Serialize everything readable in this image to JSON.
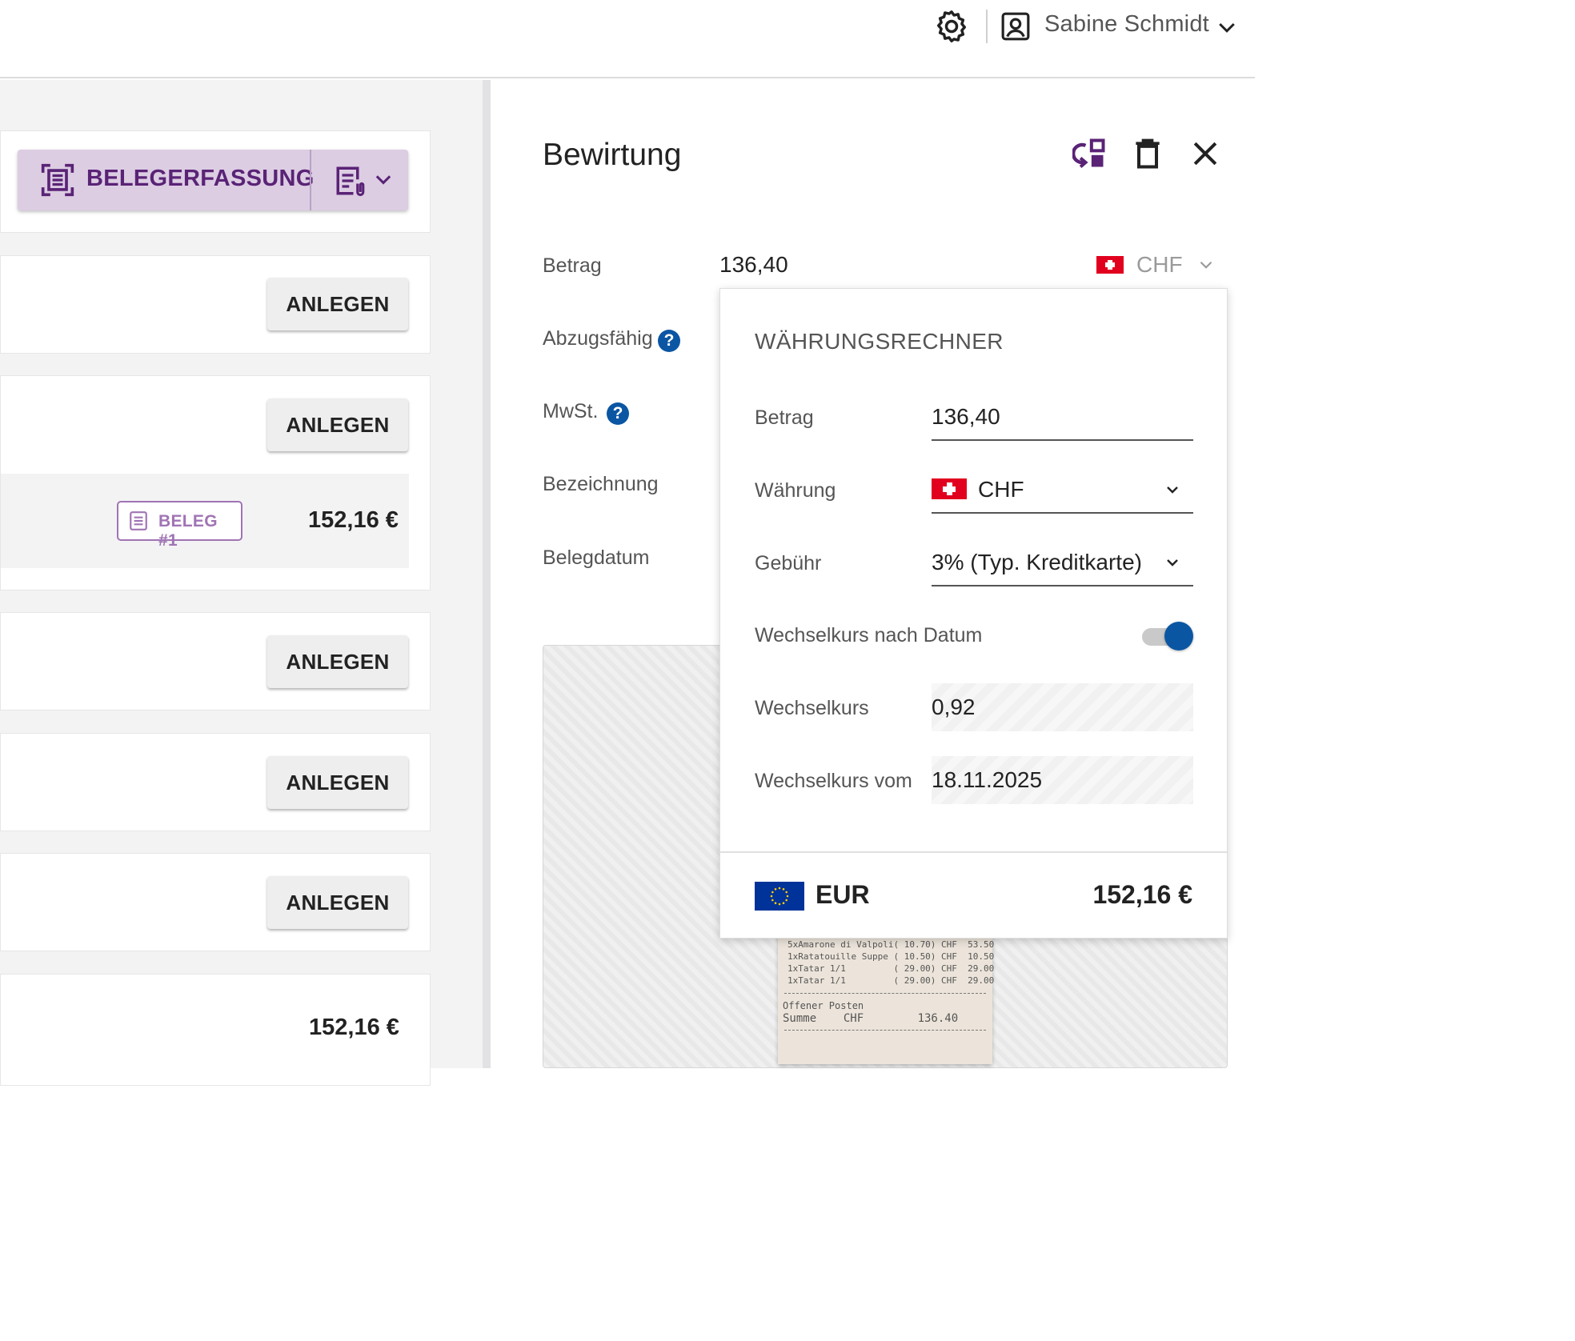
{
  "header": {
    "user_name": "Sabine Schmidt",
    "icons": [
      "gear-icon",
      "user-icon",
      "chevron-down-icon"
    ]
  },
  "left_panel": {
    "capture_button_label": "BELEGERFASSUNG",
    "create_label": "ANLEGEN",
    "receipt_chip_label": "BELEG #1",
    "receipt_amount": "152,16 €",
    "bottom_amount": "152,16 €"
  },
  "detail": {
    "title": "Bewirtung",
    "fields": {
      "betrag": "Betrag",
      "abzugsfaehig": "Abzugsfähig",
      "mwst": "MwSt.",
      "bezeichnung": "Bezeichnung",
      "belegdatum": "Belegdatum"
    },
    "help_symbol": "?",
    "amount_value": "136,40",
    "currency": "CHF",
    "accent_color": "#5a2376",
    "toggle_color": "#0b56a3"
  },
  "converter": {
    "title": "WÄHRUNGSRECHNER",
    "betrag_label": "Betrag",
    "betrag_value": "136,40",
    "waehrung_label": "Währung",
    "waehrung_value": "CHF",
    "gebuehr_label": "Gebühr",
    "gebuehr_value": "3% (Typ. Kreditkarte)",
    "toggle_label": "Wechselkurs nach Datum",
    "toggle_on": true,
    "kurs_label": "Wechselkurs",
    "kurs_value": "0,92",
    "kurs_datum_label": "Wechselkurs vom",
    "kurs_datum_value": "18.11.2025",
    "result_currency": "EUR",
    "result_amount": "152,16 €"
  },
  "receipt_image": {
    "lines": [
      "5xAmarone di Valpoli( 10.70) CHF  53.50",
      "1xRatatouille Suppe ( 10.50) CHF  10.50",
      "1xTatar 1/1         ( 29.00) CHF  29.00",
      "1xTatar 1/1         ( 29.00) CHF  29.00"
    ],
    "open_label": "Offener Posten",
    "sum_line": "Summe    CHF        136.40"
  }
}
